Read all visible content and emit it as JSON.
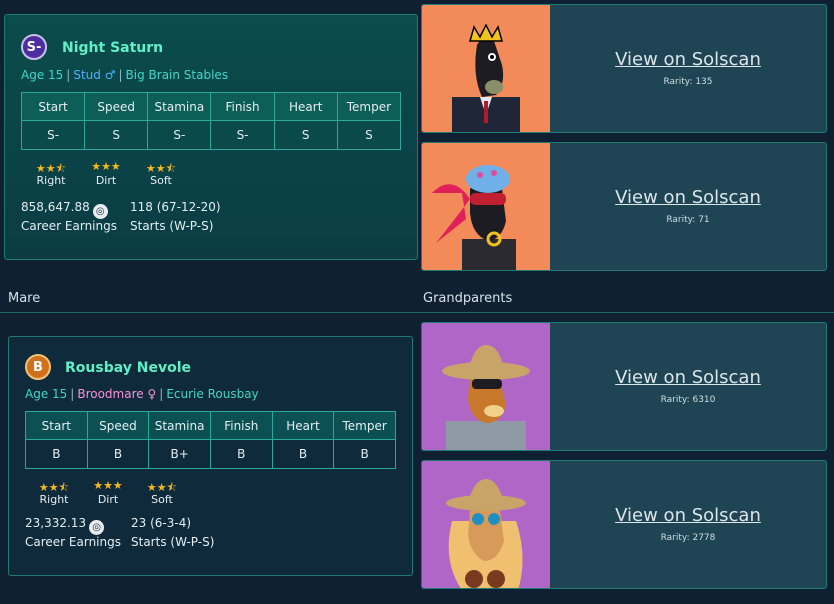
{
  "stud": {
    "grade": "S-",
    "name": "Night Saturn",
    "age": "Age 15",
    "role": "Stud",
    "role_symbol": "♂",
    "stable": "Big Brain Stables",
    "stats_headers": [
      "Start",
      "Speed",
      "Stamina",
      "Finish",
      "Heart",
      "Temper"
    ],
    "stats_values": [
      "S-",
      "S",
      "S-",
      "S-",
      "S",
      "S"
    ],
    "prefs": [
      {
        "stars": "★★⯪",
        "label": "Right"
      },
      {
        "stars": "★★★",
        "label": "Dirt"
      },
      {
        "stars": "★★⯪",
        "label": "Soft"
      }
    ],
    "earnings_value": "858,647.88",
    "earnings_label": "Career Earnings",
    "starts_value": "118 (67-12-20)",
    "starts_label": "Starts (W-P-S)"
  },
  "mare_section_label": "Mare",
  "grandparents_section_label": "Grandparents",
  "mare": {
    "grade": "B",
    "name": "Rousbay Nevole",
    "age": "Age 15",
    "role": "Broodmare",
    "role_symbol": "♀",
    "stable": "Ecurie Rousbay",
    "stats_headers": [
      "Start",
      "Speed",
      "Stamina",
      "Finish",
      "Heart",
      "Temper"
    ],
    "stats_values": [
      "B",
      "B",
      "B+",
      "B",
      "B",
      "B"
    ],
    "prefs": [
      {
        "stars": "★★⯪",
        "label": "Right"
      },
      {
        "stars": "★★★",
        "label": "Dirt"
      },
      {
        "stars": "★★⯪",
        "label": "Soft"
      }
    ],
    "earnings_value": "23,332.13",
    "earnings_label": "Career Earnings",
    "starts_value": "23 (6-3-4)",
    "starts_label": "Starts (W-P-S)"
  },
  "coin_icon": "coin-icon",
  "grandparents": [
    {
      "link": "View on Solscan",
      "rarity": "Rarity: 135",
      "bg": "#f28a5a",
      "art": "crowned-horse-in-suit"
    },
    {
      "link": "View on Solscan",
      "rarity": "Rarity: 71",
      "bg": "#f28a5a",
      "art": "horse-with-helmet-and-goggles"
    },
    {
      "link": "View on Solscan",
      "rarity": "Rarity: 6310",
      "bg": "#b066c6",
      "art": "horse-in-straw-hat"
    },
    {
      "link": "View on Solscan",
      "rarity": "Rarity: 2778",
      "bg": "#b066c6",
      "art": "blonde-horse-in-straw-hat"
    }
  ]
}
